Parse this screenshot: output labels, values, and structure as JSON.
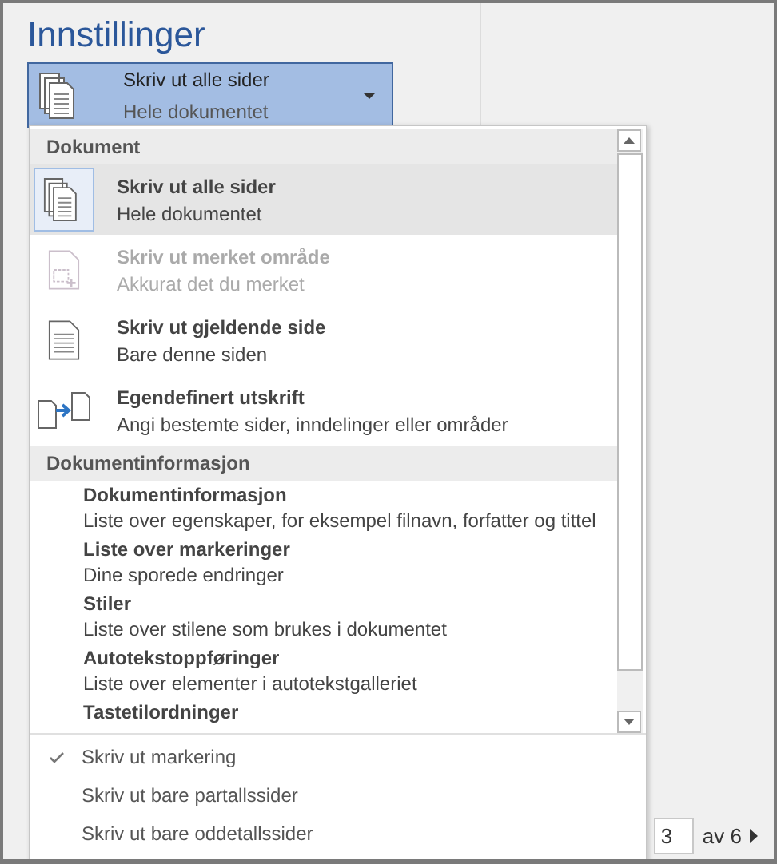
{
  "section_title": "Innstillinger",
  "print_range": {
    "title": "Skriv ut alle sider",
    "subtitle": "Hele dokumentet",
    "expanded": true
  },
  "menu": {
    "groups": [
      {
        "header": "Dokument",
        "items": [
          {
            "kind": "pages",
            "title": "Skriv ut alle sider",
            "subtitle": "Hele dokumentet",
            "selected": true,
            "disabled": false
          },
          {
            "kind": "selection",
            "title": "Skriv ut merket område",
            "subtitle": "Akkurat det du merket",
            "selected": false,
            "disabled": true
          },
          {
            "kind": "page",
            "title": "Skriv ut gjeldende side",
            "subtitle": "Bare denne siden",
            "selected": false,
            "disabled": false
          },
          {
            "kind": "custom",
            "title": "Egendefinert utskrift",
            "subtitle": "Angi bestemte sider, inndelinger eller områder",
            "selected": false,
            "disabled": false
          }
        ]
      },
      {
        "header": "Dokumentinformasjon",
        "items": [
          {
            "kind": "text",
            "title": "Dokumentinformasjon",
            "subtitle": "Liste over egenskaper, for eksempel filnavn, forfatter og tittel",
            "selected": false,
            "disabled": false
          },
          {
            "kind": "text",
            "title": "Liste over markeringer",
            "subtitle": "Dine sporede endringer",
            "selected": false,
            "disabled": false
          },
          {
            "kind": "text",
            "title": "Stiler",
            "subtitle": "Liste over stilene som brukes i dokumentet",
            "selected": false,
            "disabled": false
          },
          {
            "kind": "text",
            "title": "Autotekstoppføringer",
            "subtitle": "Liste over elementer i autotekstgalleriet",
            "selected": false,
            "disabled": false
          },
          {
            "kind": "text",
            "title": "Tastetilordninger",
            "selected": false,
            "disabled": false
          }
        ]
      }
    ],
    "options": [
      {
        "label": "Skriv ut markering",
        "checked": true
      },
      {
        "label": "Skriv ut bare partallssider",
        "checked": false
      },
      {
        "label": "Skriv ut bare oddetallssider",
        "checked": false
      }
    ]
  },
  "pager": {
    "page": "3",
    "total": "av 6"
  }
}
